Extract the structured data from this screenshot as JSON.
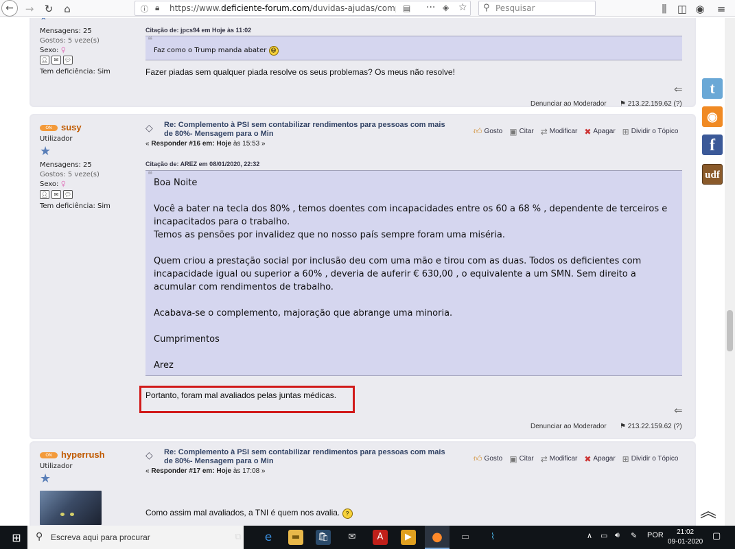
{
  "browser": {
    "url_prefix": "https://www.",
    "url_domain": "deficiente-forum.com",
    "url_path": "/duvidas-ajudas/compleme",
    "search_placeholder": "Pesquisar"
  },
  "post1": {
    "meta_messages": "Mensagens: 25",
    "meta_likes": "Gostos: 5 veze(s)",
    "meta_sex": "Sexo:",
    "meta_disability": "Tem deficiência: Sim",
    "quote_header": "Citação de: jpcs94 em Hoje às 11:02",
    "quote_text": "Faz como o Trump manda abater",
    "body": "Fazer piadas sem qualquer piada resolve os seus problemas? Os meus não resolve!",
    "report": "Denunciar ao Moderador",
    "ip": "213.22.159.62 (?)"
  },
  "post2": {
    "author": "susy",
    "status": "ON",
    "role": "Utilizador",
    "meta_messages": "Mensagens: 25",
    "meta_likes": "Gostos: 5 veze(s)",
    "meta_sex": "Sexo:",
    "meta_disability": "Tem deficiência: Sim",
    "title": "Re: Complemento à PSI sem contabilizar rendimentos para pessoas com mais de 80%- Mensagem para o Min",
    "reply_prefix": "« ",
    "reply_label": "Responder #16 em:",
    "reply_day": "Hoje",
    "reply_time": "às 15:53 »",
    "quote_header": "Citação de: AREZ em 08/01/2020, 22:32",
    "quote_text": "Boa Noite\n\nVocê a bater na tecla dos 80% , temos doentes com incapacidades entre os 60 a 68 % , dependente de terceiros e incapacitados para o trabalho.\nTemos as pensões por invalidez que no nosso país sempre foram uma miséria.\n\nQuem criou a prestação social por inclusão deu com uma mão e tirou com as duas. Todos os deficientes com incapacidade igual ou superior a 60% , deveria de auferir € 630,00 , o equivalente a um SMN. Sem direito a acumular com rendimentos de trabalho.\n\nAcabava-se o complemento, majoração que abrange uma minoria.\n\nCumprimentos\n\nArez",
    "body": "Portanto, foram mal avaliados pelas juntas médicas.",
    "report": "Denunciar ao Moderador",
    "ip": "213.22.159.62 (?)"
  },
  "post3": {
    "author": "hyperrush",
    "status": "ON",
    "role": "Utilizador",
    "title": "Re: Complemento à PSI sem contabilizar rendimentos para pessoas com mais de 80%- Mensagem para o Min",
    "reply_prefix": "« ",
    "reply_label": "Responder #17 em:",
    "reply_day": "Hoje",
    "reply_time": "às 17:08 »",
    "body": "Como assim mal avaliados, a TNI é quem nos avalia."
  },
  "actions": {
    "like": "Gosto",
    "quote": "Citar",
    "modify": "Modificar",
    "delete": "Apagar",
    "split": "Dividir o Tópico"
  },
  "social": {
    "udf": "udf"
  },
  "taskbar": {
    "search": "Escreva aqui para procurar",
    "lang": "POR",
    "time": "21:02",
    "date": "09-01-2020"
  }
}
